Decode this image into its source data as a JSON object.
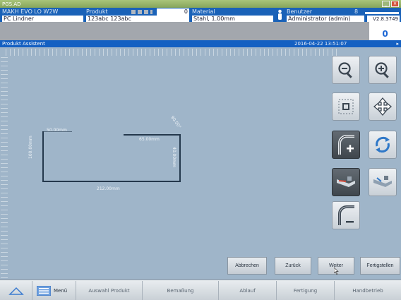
{
  "window": {
    "title": "PGS.AD"
  },
  "header": {
    "machine": "MAKH EVO LO W2W",
    "operator": "PC Lindner",
    "product_label": "Produkt",
    "product_code": "123abc 123abc",
    "product_count": "0",
    "material_label": "Material",
    "material_value": "Stahl, 1.00mm",
    "user_label": "Benutzer",
    "user_number": "8",
    "user_value": "Administrator (admin)",
    "version": "V2.8.3749",
    "counter": "0"
  },
  "assistant_bar": {
    "title": "Produkt Assistent",
    "timestamp": "2016-04-22 13:51:07"
  },
  "drawing": {
    "dim_left_top": "50.00mm",
    "dim_left_vertical": "100.00mm",
    "dim_top_right": "65.00mm",
    "dim_right_vertical": "40.00mm",
    "dim_bottom": "212.00mm",
    "dim_angle": "90.00°"
  },
  "tools": [
    {
      "name": "zoom-out-icon"
    },
    {
      "name": "zoom-in-icon"
    },
    {
      "name": "fit-view-icon"
    },
    {
      "name": "pan-icon"
    },
    {
      "name": "add-bend-icon"
    },
    {
      "name": "rotate-icon"
    },
    {
      "name": "machine-view-icon"
    },
    {
      "name": "flip-part-icon"
    },
    {
      "name": "remove-bend-icon"
    }
  ],
  "actions": {
    "cancel": "Abbrechen",
    "back": "Zurück",
    "next": "Weiter",
    "finish": "Fertigstellen"
  },
  "nav": {
    "menu": "Menü",
    "select_product": "Auswahl Produkt",
    "dimensioning": "Bemaßung",
    "sequence": "Ablauf",
    "production": "Fertigung",
    "manual": "Handbetrieb"
  },
  "colors": {
    "header_blue": "#1a62b8",
    "canvas": "#9fb5c9",
    "titlebar_green": "#8faf62"
  }
}
